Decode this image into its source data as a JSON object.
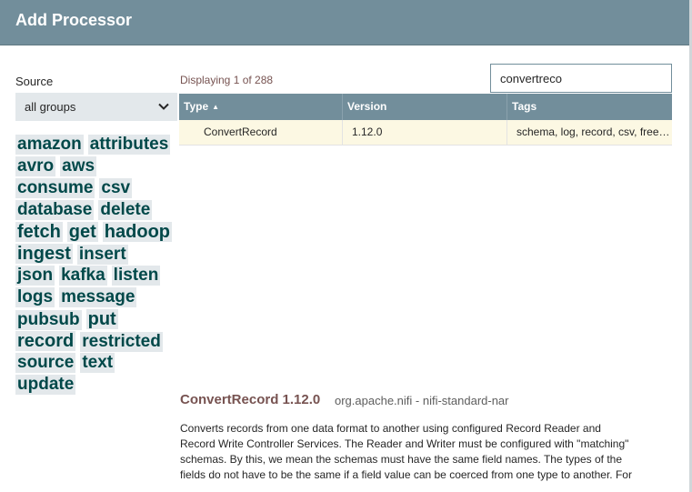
{
  "dialog": {
    "title": "Add Processor"
  },
  "source": {
    "label": "Source",
    "selected": "all groups"
  },
  "tag_cloud": [
    [
      "amazon",
      "attributes"
    ],
    [
      "avro",
      "aws"
    ],
    [
      "consume",
      "csv"
    ],
    [
      "database",
      "delete"
    ],
    [
      "fetch",
      "get",
      "hadoop"
    ],
    [
      "ingest",
      "insert"
    ],
    [
      "json",
      "kafka",
      "listen"
    ],
    [
      "logs",
      "message"
    ],
    [
      "pubsub",
      "put"
    ],
    [
      "record",
      "restricted"
    ],
    [
      "source",
      "text"
    ],
    [
      "update"
    ]
  ],
  "results": {
    "displaying": "Displaying 1 of 288",
    "search_value": "convertreco",
    "columns": {
      "type": "Type",
      "version": "Version",
      "tags": "Tags"
    },
    "rows": [
      {
        "type": "ConvertRecord",
        "version": "1.12.0",
        "tags": "schema, log, record, csv, freeform, text, json, avro, convert, generic"
      }
    ]
  },
  "details": {
    "title": "ConvertRecord 1.12.0",
    "bundle": "org.apache.nifi - nifi-standard-nar",
    "description_lines": [
      "Converts records from one data format to another using configured Record Reader and",
      "Record Write Controller Services. The Reader and Writer must be configured with \"matching\"",
      "schemas. By this, we mean the schemas must have the same field names. The types of the",
      "fields do not have to be the same if a field value can be coerced from one type to another. For"
    ]
  }
}
